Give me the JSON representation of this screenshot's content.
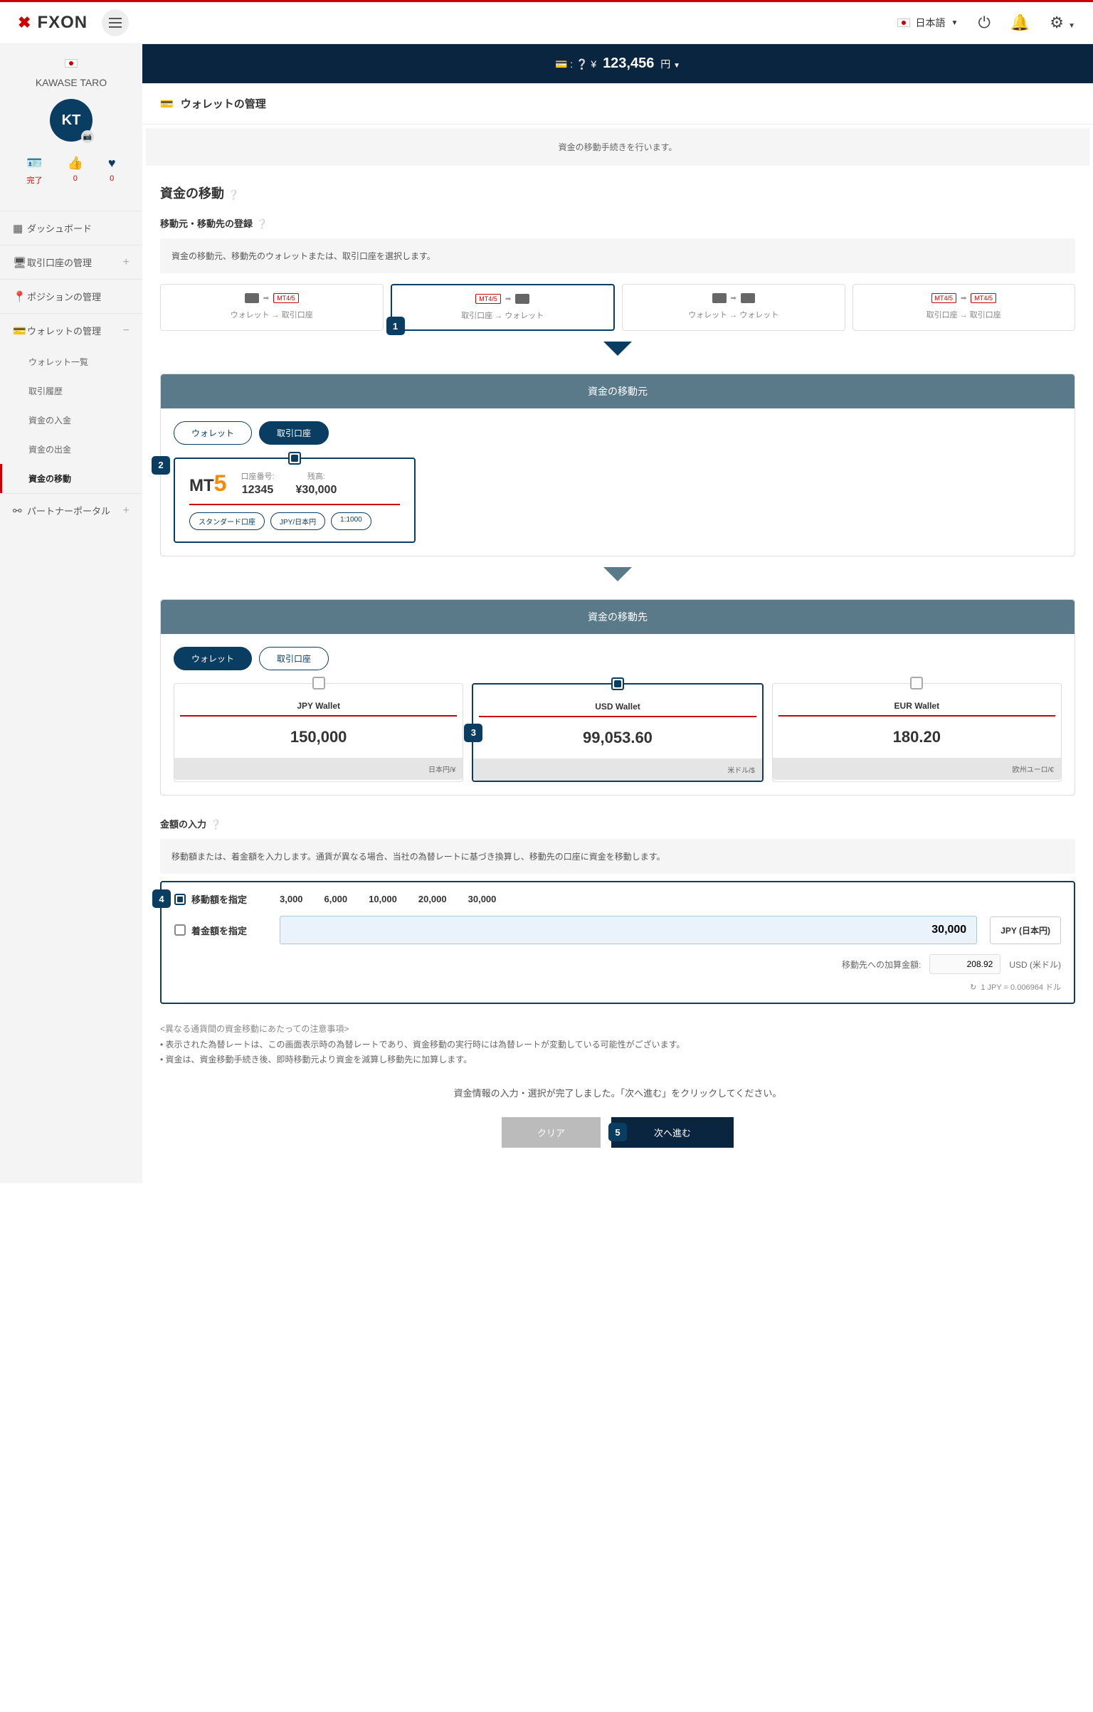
{
  "header": {
    "logo": "FXON",
    "language": "日本語"
  },
  "profile": {
    "name": "KAWASE TARO",
    "initials": "KT",
    "stats": {
      "complete_label": "完了",
      "likes": "0",
      "favorites": "0"
    }
  },
  "nav": {
    "dashboard": "ダッシュボード",
    "accounts": "取引口座の管理",
    "positions": "ポジションの管理",
    "wallet": "ウォレットの管理",
    "wallet_list": "ウォレット一覧",
    "history": "取引履歴",
    "deposit": "資金の入金",
    "withdraw": "資金の出金",
    "transfer": "資金の移動",
    "partner": "パートナーポータル"
  },
  "balance": {
    "currency": "¥",
    "amount": "123,456",
    "unit": "円"
  },
  "page": {
    "title": "ウォレットの管理",
    "info_strip": "資金の移動手続きを行います。",
    "section_title": "資金の移動",
    "sub_title": "移動元・移動先の登録",
    "gray_instruction": "資金の移動元、移動先のウォレットまたは、取引口座を選択します。"
  },
  "transfer_types": [
    {
      "label": "ウォレット → 取引口座"
    },
    {
      "label": "取引口座 → ウォレット"
    },
    {
      "label": "ウォレット → ウォレット"
    },
    {
      "label": "取引口座 → 取引口座"
    }
  ],
  "source": {
    "header": "資金の移動元",
    "toggle_wallet": "ウォレット",
    "toggle_account": "取引口座",
    "account": {
      "platform_mt": "MT",
      "platform_num": "5",
      "number_label": "口座番号:",
      "number": "12345",
      "balance_label": "残高:",
      "balance": "¥30,000",
      "tags": [
        "スタンダード口座",
        "JPY/日本円",
        "1:1000"
      ]
    }
  },
  "dest": {
    "header": "資金の移動先",
    "toggle_wallet": "ウォレット",
    "toggle_account": "取引口座",
    "wallets": [
      {
        "name": "JPY Wallet",
        "amount": "150,000",
        "footer": "日本円/¥"
      },
      {
        "name": "USD Wallet",
        "amount": "99,053.60",
        "footer": "米ドル/$"
      },
      {
        "name": "EUR Wallet",
        "amount": "180.20",
        "footer": "欧州ユーロ/€"
      }
    ]
  },
  "amount_section": {
    "title": "金額の入力",
    "instruction": "移動額または、着金額を入力します。通貨が異なる場合、当社の為替レートに基づき換算し、移動先の口座に資金を移動します。",
    "radio_transfer": "移動額を指定",
    "radio_receive": "着金額を指定",
    "presets": [
      "3,000",
      "6,000",
      "10,000",
      "20,000",
      "30,000"
    ],
    "input_value": "30,000",
    "input_currency": "JPY (日本円)",
    "converted_label": "移動先への加算金額:",
    "converted_value": "208.92",
    "converted_currency": "USD (米ドル)",
    "rate": "1 JPY = 0.006964 ドル"
  },
  "notes": {
    "title": "<異なる通貨間の資金移動にあたっての注意事項>",
    "items": [
      "表示された為替レートは、この画面表示時の為替レートであり、資金移動の実行時には為替レートが変動している可能性がございます。",
      "資金は、資金移動手続き後、即時移動元より資金を減算し移動先に加算します。"
    ]
  },
  "complete_msg": "資金情報の入力・選択が完了しました。「次へ進む」をクリックしてください。",
  "buttons": {
    "clear": "クリア",
    "next": "次へ進む"
  },
  "steps": {
    "s1": "1",
    "s2": "2",
    "s3": "3",
    "s4": "4",
    "s5": "5"
  }
}
